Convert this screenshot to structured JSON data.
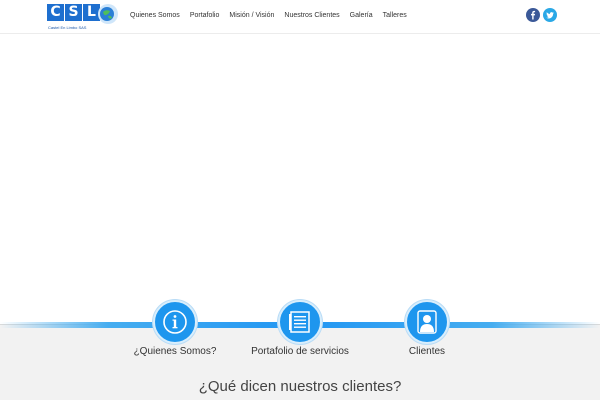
{
  "header": {
    "logo": {
      "letters": [
        "C",
        "S",
        "L"
      ],
      "tagline": "Castel En Limbo SAS"
    },
    "nav": [
      {
        "label": "Quienes Somos"
      },
      {
        "label": "Portafolio"
      },
      {
        "label": "Misión / Visión"
      },
      {
        "label": "Nuestros Clientes"
      },
      {
        "label": "Galería"
      },
      {
        "label": "Talleres"
      }
    ],
    "social": [
      {
        "icon": "facebook-icon",
        "color": "#3b5998"
      },
      {
        "icon": "twitter-icon",
        "color": "#2aa8e6"
      }
    ]
  },
  "services": [
    {
      "label": "¿Quienes Somos?",
      "icon": "info-icon"
    },
    {
      "label": "Portafolio de servicios",
      "icon": "document-icon"
    },
    {
      "label": "Clientes",
      "icon": "user-icon"
    }
  ],
  "testimonials": {
    "title": "¿Qué dicen nuestros clientes?"
  },
  "colors": {
    "accent": "#1e96ee",
    "brand": "#1e6fcf",
    "section_bg": "#f2f2f2"
  }
}
